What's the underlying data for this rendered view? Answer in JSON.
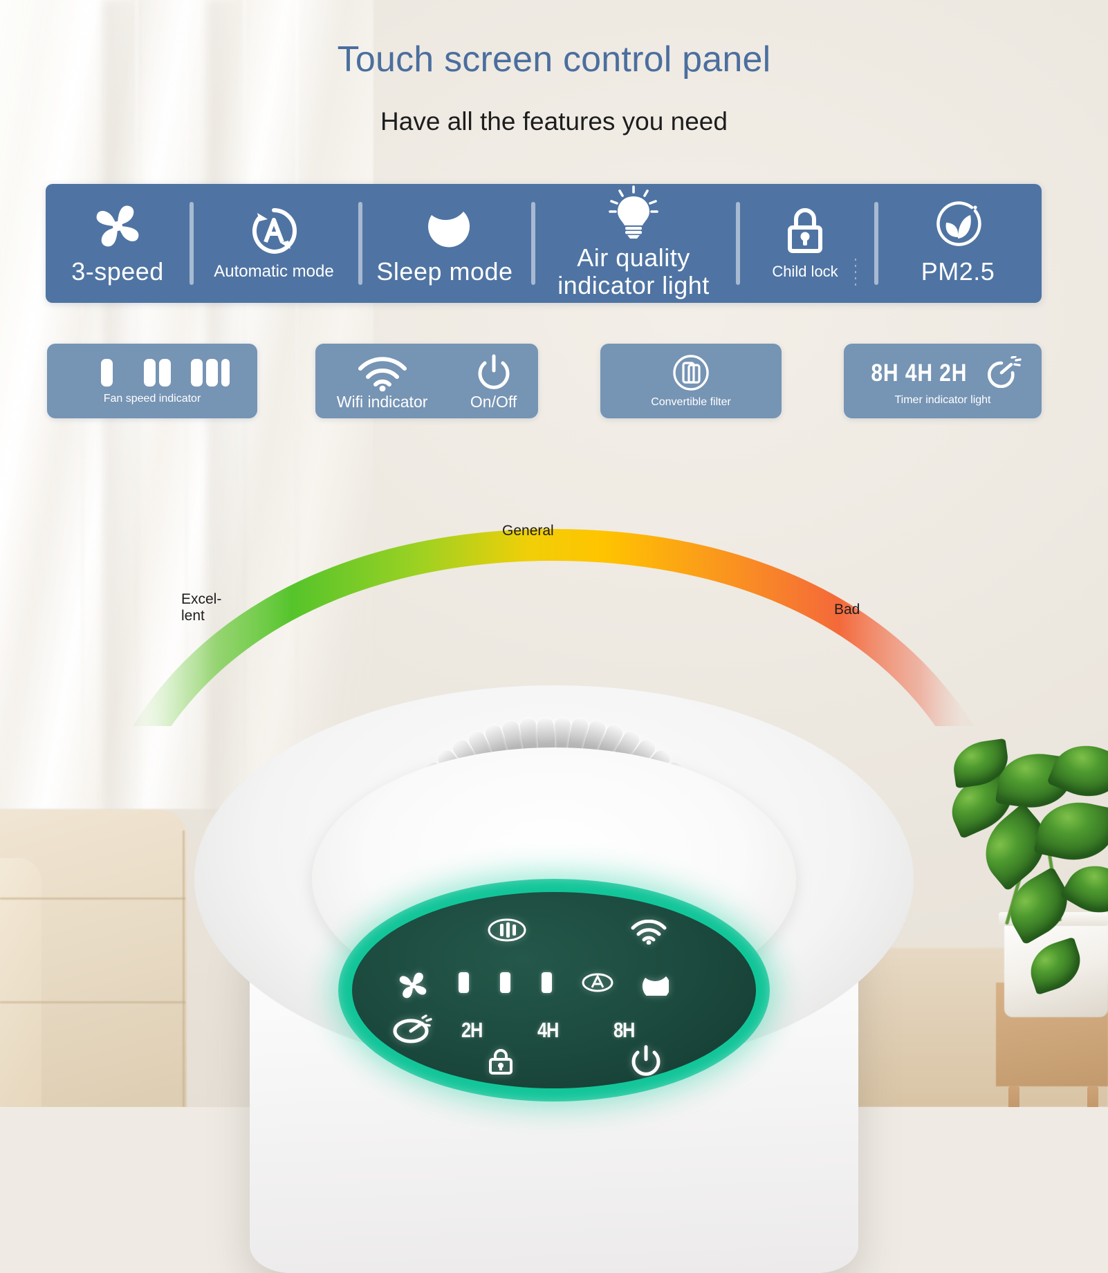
{
  "header": {
    "title": "Touch screen control panel",
    "subtitle": "Have all the features you need",
    "title_color": "#4a6e9e"
  },
  "feature_bar": {
    "background_color": "#4f74a3",
    "items": [
      {
        "label": "3-speed",
        "icon": "fan-icon",
        "style": "big"
      },
      {
        "label": "Automatic mode",
        "icon": "auto-mode-icon",
        "style": "normal"
      },
      {
        "label": "Sleep mode",
        "icon": "moon-icon",
        "style": "big"
      },
      {
        "label": "Air quality indicator light",
        "icon": "lightbulb-icon",
        "style": "big"
      },
      {
        "label": "Child lock",
        "icon": "padlock-icon",
        "style": "small"
      },
      {
        "label": "PM2.5",
        "icon": "leaf-circle-icon",
        "style": "big"
      }
    ]
  },
  "cards": {
    "background_color": "#7694b4",
    "fan_speed": {
      "label": "Fan speed indicator",
      "icon": "speed-bars-icon"
    },
    "wifi": {
      "label": "Wifi indicator",
      "icon": "wifi-icon"
    },
    "power": {
      "label": "On/Off",
      "icon": "power-icon"
    },
    "filter": {
      "label": "Convertible filter",
      "icon": "convertible-filter-icon"
    },
    "timer": {
      "hours": "8H 4H 2H",
      "label": "Timer indicator light",
      "icon": "timer-icon"
    }
  },
  "air_quality_arc": {
    "labels": {
      "left": "Excel-\nlent",
      "left_line1": "Excel-",
      "left_line2": "lent",
      "middle": "General",
      "right": "Bad"
    },
    "colors": {
      "excellent": "#55c42b",
      "general": "#ffc400",
      "bad": "#f4693a"
    }
  },
  "device_panel": {
    "ring_color": "#12c79a",
    "screen_color": "#1c4a3e",
    "icons": [
      "filter-status-icon",
      "wifi-icon",
      "fan-icon",
      "speed-bar-1",
      "speed-bar-2",
      "speed-bar-3",
      "auto-mode-icon",
      "moon-icon",
      "timer-icon",
      "child-lock-icon",
      "power-icon"
    ],
    "timer_labels": [
      "2H",
      "4H",
      "8H"
    ]
  }
}
